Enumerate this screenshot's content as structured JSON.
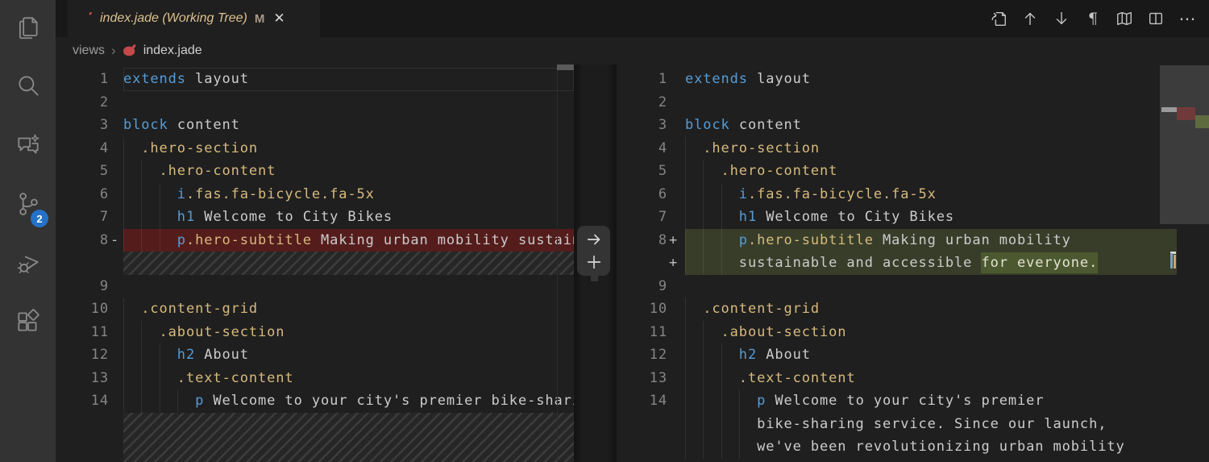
{
  "activity_bar": {
    "items": [
      {
        "name": "explorer"
      },
      {
        "name": "search"
      },
      {
        "name": "chat"
      },
      {
        "name": "source-control",
        "badge": "2"
      },
      {
        "name": "run-and-debug"
      },
      {
        "name": "extensions"
      }
    ],
    "badge_color": "#2472c8"
  },
  "tab_bar": {
    "active_tab": {
      "title": "index.jade (Working Tree)",
      "modified_badge": "M",
      "close_glyph": "✕",
      "file_icon": "pug-icon"
    }
  },
  "toolbar": {
    "icons": [
      "open-file",
      "previous-change",
      "next-change",
      "toggle-whitespace",
      "map",
      "split-editor",
      "more-actions"
    ],
    "pilcrow_glyph": "¶",
    "more_glyph": "⋯"
  },
  "breadcrumb": {
    "folder": "views",
    "separator": "›",
    "file": "index.jade",
    "file_icon": "pug-icon"
  },
  "diff_widget": {
    "revert_glyph": "→",
    "plus_glyph": "+"
  },
  "colors": {
    "activity_bar_bg": "#333333",
    "tab_bar_bg": "#181818",
    "editor_bg": "#1f1f1f",
    "deleted_line_bg": "#551c1c",
    "added_line_bg": "#373d29",
    "added_word_bg": "#4c5930",
    "keyword": "#569cd6",
    "class_name": "#d7ba7d",
    "plain_text": "#cccccc",
    "line_number": "#858585",
    "modified_file": "#dcc08f",
    "pug_icon_red": "#c4494b"
  },
  "editors": {
    "left": {
      "rows": [
        {
          "n": "1",
          "cur": true,
          "tok": [
            [
              "kw",
              "extends"
            ],
            [
              "pl",
              " layout"
            ]
          ]
        },
        {
          "n": "2"
        },
        {
          "n": "3",
          "tok": [
            [
              "kw",
              "block"
            ],
            [
              "pl",
              " content"
            ]
          ]
        },
        {
          "n": "4",
          "g": 1,
          "tok": [
            [
              "cls",
              "  .hero-section"
            ]
          ]
        },
        {
          "n": "5",
          "g": 2,
          "tok": [
            [
              "cls",
              "    .hero-content"
            ]
          ]
        },
        {
          "n": "6",
          "g": 3,
          "tok": [
            [
              "kw",
              "      i"
            ],
            [
              "cls",
              ".fas.fa-bicycle.fa-5x"
            ]
          ]
        },
        {
          "n": "7",
          "g": 3,
          "tok": [
            [
              "kw",
              "      h1"
            ],
            [
              "pl",
              " Welcome to City Bikes"
            ]
          ]
        },
        {
          "n": "8",
          "m": "-",
          "t": "del",
          "g": 3,
          "tok": [
            [
              "kw",
              "      p"
            ],
            [
              "cls",
              ".hero-subtitle"
            ],
            [
              "pl",
              " Making urban mobility sustainable and accessible."
            ]
          ]
        },
        {
          "t": "spacer",
          "h": 28.5
        },
        {
          "n": "9"
        },
        {
          "n": "10",
          "g": 1,
          "tok": [
            [
              "cls",
              "  .content-grid"
            ]
          ]
        },
        {
          "n": "11",
          "g": 2,
          "tok": [
            [
              "cls",
              "    .about-section"
            ]
          ]
        },
        {
          "n": "12",
          "g": 3,
          "tok": [
            [
              "kw",
              "      h2"
            ],
            [
              "pl",
              " About"
            ]
          ]
        },
        {
          "n": "13",
          "g": 3,
          "tok": [
            [
              "cls",
              "      .text-content"
            ]
          ]
        },
        {
          "n": "14",
          "g": 4,
          "tok": [
            [
              "kw",
              "        p"
            ],
            [
              "pl",
              " Welcome to your city's premier bike-sharing service. Since our launch,"
            ]
          ]
        },
        {
          "t": "spacer",
          "h": 62
        }
      ]
    },
    "right": {
      "rows": [
        {
          "n": "1",
          "tok": [
            [
              "kw",
              "extends"
            ],
            [
              "pl",
              " layout"
            ]
          ]
        },
        {
          "n": "2"
        },
        {
          "n": "3",
          "tok": [
            [
              "kw",
              "block"
            ],
            [
              "pl",
              " content"
            ]
          ]
        },
        {
          "n": "4",
          "g": 1,
          "tok": [
            [
              "cls",
              "  .hero-section"
            ]
          ]
        },
        {
          "n": "5",
          "g": 2,
          "tok": [
            [
              "cls",
              "    .hero-content"
            ]
          ]
        },
        {
          "n": "6",
          "g": 3,
          "tok": [
            [
              "kw",
              "      i"
            ],
            [
              "cls",
              ".fas.fa-bicycle.fa-5x"
            ]
          ]
        },
        {
          "n": "7",
          "g": 3,
          "tok": [
            [
              "kw",
              "      h1"
            ],
            [
              "pl",
              " Welcome to City Bikes"
            ]
          ]
        },
        {
          "n": "8",
          "m": "+",
          "t": "add",
          "g": 3,
          "tok": [
            [
              "kw",
              "      p"
            ],
            [
              "cls",
              ".hero-subtitle"
            ],
            [
              "pl",
              " Making urban mobility"
            ]
          ]
        },
        {
          "m": "+",
          "t": "add",
          "g": 3,
          "tok": [
            [
              "pl",
              "      sustainable and accessible "
            ],
            [
              "hl",
              "for everyone."
            ]
          ]
        },
        {
          "n": "9"
        },
        {
          "n": "10",
          "g": 1,
          "tok": [
            [
              "cls",
              "  .content-grid"
            ]
          ]
        },
        {
          "n": "11",
          "g": 2,
          "tok": [
            [
              "cls",
              "    .about-section"
            ]
          ]
        },
        {
          "n": "12",
          "g": 3,
          "tok": [
            [
              "kw",
              "      h2"
            ],
            [
              "pl",
              " About"
            ]
          ]
        },
        {
          "n": "13",
          "g": 3,
          "tok": [
            [
              "cls",
              "      .text-content"
            ]
          ]
        },
        {
          "n": "14",
          "g": 4,
          "tok": [
            [
              "kw",
              "        p"
            ],
            [
              "pl",
              " Welcome to your city's premier"
            ]
          ]
        },
        {
          "g": 4,
          "tok": [
            [
              "pl",
              "        bike-sharing service. Since our launch,"
            ]
          ]
        },
        {
          "g": 4,
          "tok": [
            [
              "pl",
              "        we've been revolutionizing urban mobility"
            ]
          ]
        }
      ]
    }
  }
}
